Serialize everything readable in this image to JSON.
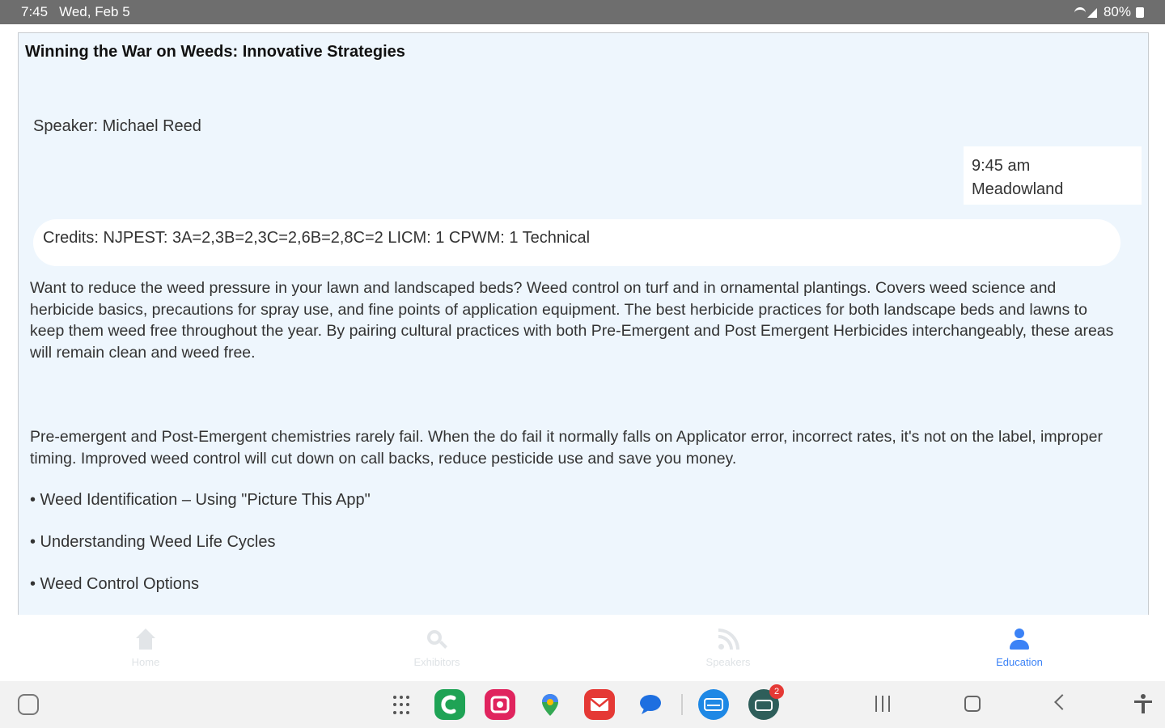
{
  "status_bar": {
    "time": "7:45",
    "date": "Wed, Feb 5",
    "battery": "80%"
  },
  "session": {
    "title": "Winning the War on Weeds: Innovative Strategies",
    "speaker": "Speaker: Michael Reed",
    "time": "9:45 am",
    "location": "Meadowland",
    "credits": "Credits: NJPEST: 3A=2,3B=2,3C=2,6B=2,8C=2 LICM: 1 CPWM: 1 Technical",
    "description_1": "Want to reduce the weed pressure in your lawn and landscaped beds? Weed control on turf and in ornamental plantings. Covers weed science and herbicide basics, precautions for spray use, and fine points of application equipment.  The best herbicide practices for both landscape beds and lawns to keep them weed free throughout the year. By pairing cultural practices with both Pre-Emergent and Post Emergent Herbicides interchangeably, these areas will remain clean and weed free.",
    "description_2": "Pre-emergent and Post-Emergent chemistries rarely fail.  When the do fail it normally falls on Applicator error, incorrect rates, it's not on the label, improper timing.   Improved weed control will cut down on call backs, reduce pesticide use and save you money.",
    "bullets": [
      "• Weed Identification – Using \"Picture This App\"",
      "• Understanding Weed Life Cycles",
      "• Weed Control Options"
    ]
  },
  "nav": {
    "home": "Home",
    "exhibitors": "Exhibitors",
    "speakers": "Speakers",
    "education": "Education"
  },
  "taskbar": {
    "apps": [
      {
        "name": "phone-app-icon",
        "color": "#1fa355"
      },
      {
        "name": "camera-app-icon",
        "color": "#e0245e"
      },
      {
        "name": "maps-app-icon",
        "color": "#ffffff"
      },
      {
        "name": "email-app-icon",
        "color": "#e53935"
      },
      {
        "name": "messages-app-icon",
        "color": "#ffffff"
      },
      {
        "name": "browser-app-icon",
        "color": "#1e88e5"
      },
      {
        "name": "store-app-icon",
        "color": "#2e5e5a"
      }
    ],
    "store_badge": "2"
  },
  "colors": {
    "accent": "#3b82f6",
    "content_bg": "#eef6fd",
    "status_bar": "#6e6e6e"
  }
}
